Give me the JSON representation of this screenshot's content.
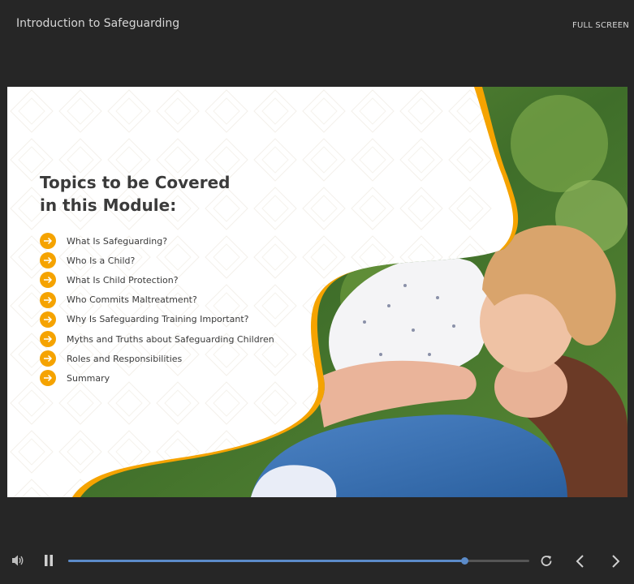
{
  "header": {
    "course_title": "Introduction to Safeguarding",
    "fullscreen_label": "FULL SCREEN"
  },
  "slide": {
    "heading_line1": "Topics to be Covered",
    "heading_line2": "in this Module:",
    "topics": [
      "What Is Safeguarding?",
      "Who Is a Child?",
      "What Is Child Protection?",
      "Who Commits Maltreatment?",
      "Why Is Safeguarding Training Important?",
      "Myths and Truths about Safeguarding Children",
      "Roles and Responsibilities",
      "Summary"
    ],
    "photo_description_icon": "photo-mother-and-child",
    "accent_color": "#f5a300"
  },
  "player": {
    "progress_fraction": 0.86,
    "progress_color": "#5b8bc9",
    "icons": [
      "volume-icon",
      "pause-icon",
      "replay-icon",
      "previous-icon",
      "next-icon"
    ]
  }
}
